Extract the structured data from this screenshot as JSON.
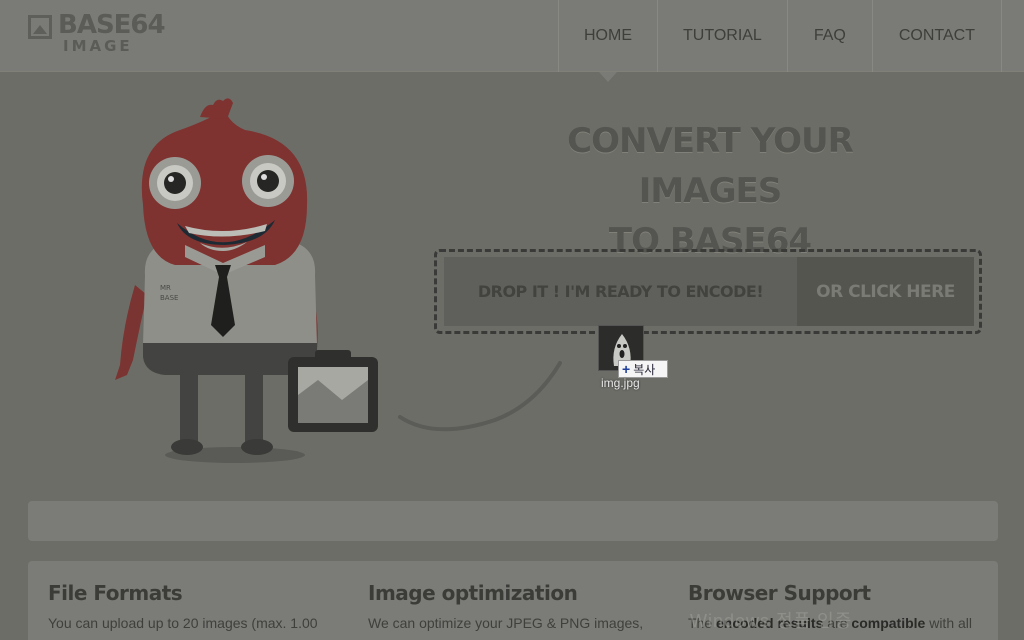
{
  "logo": {
    "main": "BASE64",
    "sub": "IMAGE"
  },
  "nav": {
    "items": [
      "HOME",
      "TUTORIAL",
      "FAQ",
      "CONTACT"
    ],
    "active": "HOME"
  },
  "hero": {
    "title_line1": "CONVERT YOUR IMAGES",
    "title_line2": "TO BASE64",
    "drop_label": "DROP IT ! I'M READY TO ENCODE!",
    "click_label": "OR CLICK HERE"
  },
  "mascot": {
    "shirt_label_line1": "MR",
    "shirt_label_line2": "BASE"
  },
  "drag": {
    "copy_label": "복사",
    "file_name": "img.jpg"
  },
  "features": [
    {
      "title": "File Formats",
      "text": "You can upload up to 20 images (max. 1.00"
    },
    {
      "title": "Image optimization",
      "text": "We can optimize your JPEG & PNG images,"
    },
    {
      "title": "Browser Support",
      "text_pre": "The ",
      "text_b1": "encoded results",
      "text_mid": " are ",
      "text_b2": "compatible",
      "text_post": " with all"
    }
  ],
  "watermark": "Windows 정품 인증",
  "colors": {
    "background": "#6d6d68",
    "mascot_red": "#7e3330",
    "dropzone_border": "#3a3a38"
  }
}
